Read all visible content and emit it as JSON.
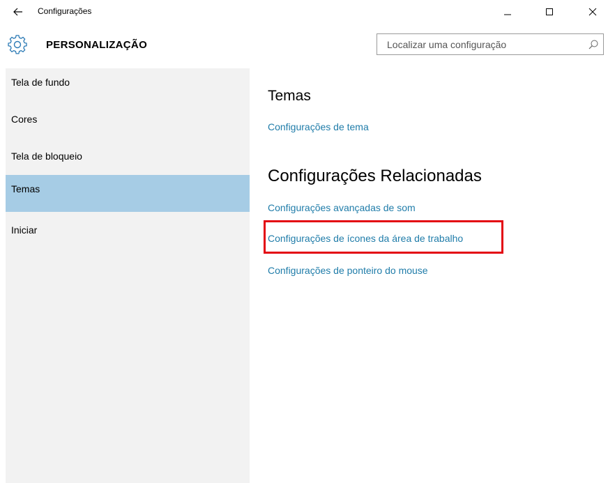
{
  "window": {
    "title": "Configurações",
    "controls": [
      "minimize",
      "maximize",
      "close"
    ]
  },
  "header": {
    "title": "PERSONALIZAÇÃO",
    "icon": "gear-icon"
  },
  "search": {
    "placeholder": "Localizar uma configuração",
    "value": ""
  },
  "sidebar": {
    "items": [
      {
        "label": "Tela de fundo",
        "selected": false
      },
      {
        "label": "Cores",
        "selected": false
      },
      {
        "label": "Tela de bloqueio",
        "selected": false
      },
      {
        "label": "Temas",
        "selected": true
      },
      {
        "label": "Iniciar",
        "selected": false
      }
    ]
  },
  "main": {
    "themes_heading": "Temas",
    "theme_settings_link": "Configurações de tema",
    "related_heading": "Configurações Relacionadas",
    "related_links": [
      "Configurações avançadas de som",
      "Configurações de ícones da área de trabalho",
      "Configurações de ponteiro do mouse"
    ]
  },
  "colors": {
    "selected_nav": "#a6cce5",
    "link": "#1f7ca9",
    "highlight": "#e30613",
    "sidebar_bg": "#f2f2f2"
  }
}
